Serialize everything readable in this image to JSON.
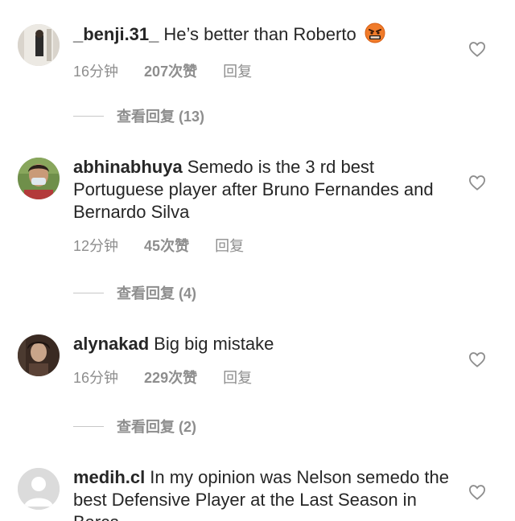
{
  "comments": [
    {
      "username": "_benji.31_",
      "text": "He’s better than Roberto",
      "emoji": "angry-face-emoji",
      "time": "16分钟",
      "likes": "207次赞",
      "reply": "回复",
      "view_replies": "查看回复 (13)"
    },
    {
      "username": "abhinabhuya",
      "text": "Semedo is the 3 rd best Portuguese player after Bruno Fernandes and Bernardo Silva",
      "time": "12分钟",
      "likes": "45次赞",
      "reply": "回复",
      "view_replies": "查看回复 (4)"
    },
    {
      "username": "alynakad",
      "text": "Big big mistake",
      "time": "16分钟",
      "likes": "229次赞",
      "reply": "回复",
      "view_replies": "查看回复 (2)"
    },
    {
      "username": "medih.cl",
      "text": "In my opinion was Nelson semedo the best Defensive Player at the Last Season in Barca"
    }
  ],
  "colors": {
    "text": "#262626",
    "secondary": "#8e8e8e",
    "divider": "#c7c7c7"
  }
}
